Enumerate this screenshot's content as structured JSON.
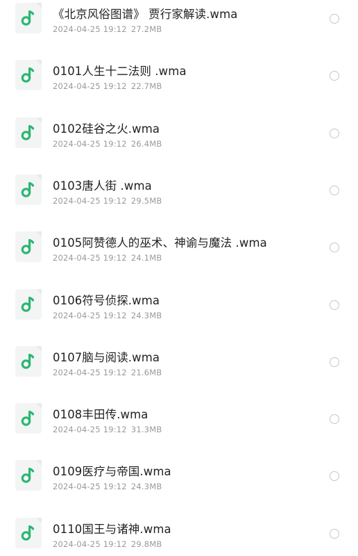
{
  "files": [
    {
      "name": "《北京风俗图谱》 贾行家解读.wma",
      "date": "2024-04-25 19:12",
      "size": "27.2MB"
    },
    {
      "name": "0101人生十二法则 .wma",
      "date": "2024-04-25 19:12",
      "size": "22.7MB"
    },
    {
      "name": "0102硅谷之火.wma",
      "date": "2024-04-25 19:12",
      "size": "26.4MB"
    },
    {
      "name": "0103唐人街 .wma",
      "date": "2024-04-25 19:12",
      "size": "29.5MB"
    },
    {
      "name": "0105阿赞德人的巫术、神谕与魔法 .wma",
      "date": "2024-04-25 19:12",
      "size": "24.1MB"
    },
    {
      "name": "0106符号侦探.wma",
      "date": "2024-04-25 19:12",
      "size": "24.3MB"
    },
    {
      "name": "0107脑与阅读.wma",
      "date": "2024-04-25 19:12",
      "size": "21.6MB"
    },
    {
      "name": "0108丰田传.wma",
      "date": "2024-04-25 19:12",
      "size": "31.3MB"
    },
    {
      "name": "0109医疗与帝国.wma",
      "date": "2024-04-25 19:12",
      "size": "24.3MB"
    },
    {
      "name": "0110国王与诸神.wma",
      "date": "2024-04-25 19:12",
      "size": "29.8MB"
    }
  ],
  "icon": "music-note-icon",
  "colors": {
    "accent": "#2bb673",
    "icon_bg": "#f3f5f4",
    "title_text": "#222222",
    "meta_text": "#9a9a9a"
  }
}
